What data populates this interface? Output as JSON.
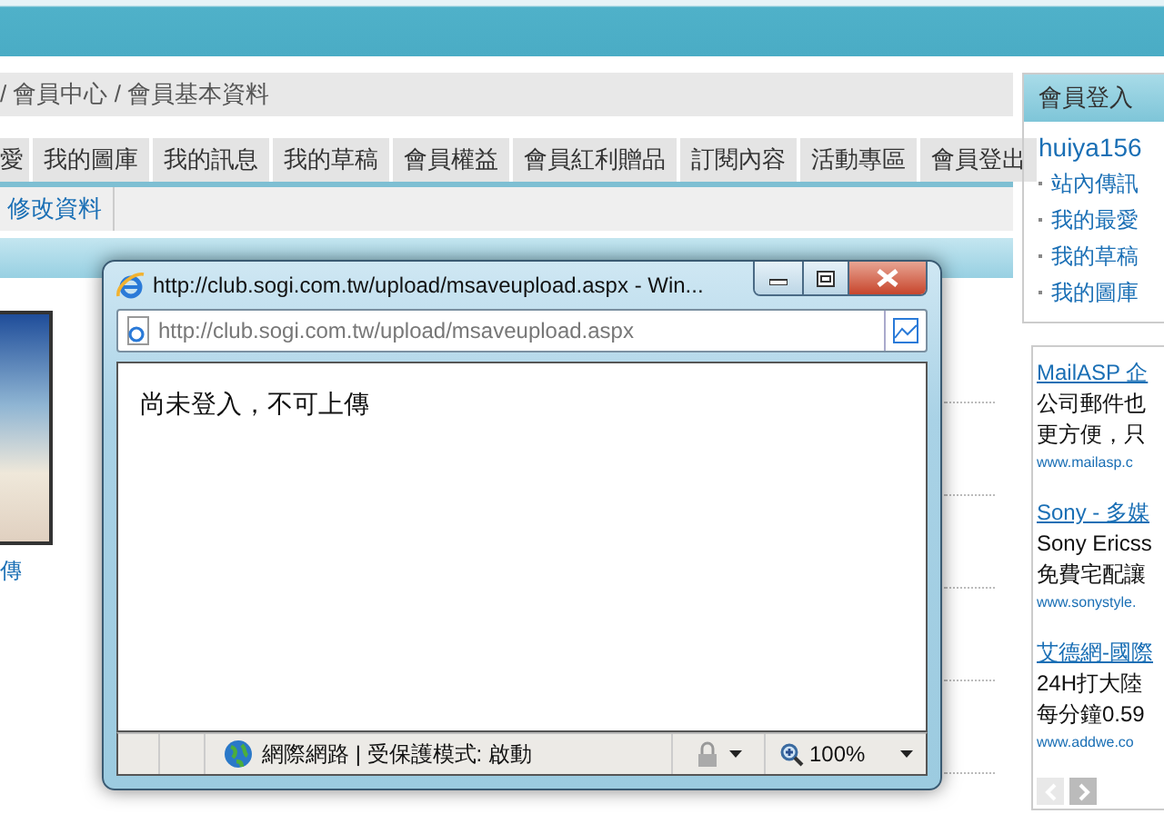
{
  "breadcrumb": "/ 會員中心 / 會員基本資料",
  "tabs": [
    {
      "label": "愛"
    },
    {
      "label": "我的圖庫"
    },
    {
      "label": "我的訊息"
    },
    {
      "label": "我的草稿"
    },
    {
      "label": "會員權益"
    },
    {
      "label": "會員紅利贈品"
    },
    {
      "label": "訂閱內容"
    },
    {
      "label": "活動專區"
    },
    {
      "label": "會員登出"
    }
  ],
  "subtabs": [
    {
      "label": "修改資料"
    }
  ],
  "photo_caption": "傳",
  "login_box": {
    "title": "會員登入",
    "username": "huiya156",
    "links": [
      "站內傳訊",
      "我的最愛",
      "我的草稿",
      "我的圖庫"
    ]
  },
  "ads": [
    {
      "title": "MailASP 企",
      "lines": [
        "公司郵件也",
        "更方便，只"
      ],
      "url": "www.mailasp.c"
    },
    {
      "title": "Sony - 多媒",
      "lines": [
        "Sony Ericss",
        "免費宅配讓"
      ],
      "url": "www.sonystyle."
    },
    {
      "title": "艾德網-國際",
      "lines": [
        "24H打大陸",
        "每分鐘0.59"
      ],
      "url": "www.addwe.co"
    }
  ],
  "popup": {
    "title": "http://club.sogi.com.tw/upload/msaveupload.aspx - Win...",
    "address": "http://club.sogi.com.tw/upload/msaveupload.aspx",
    "message": "尚未登入，不可上傳",
    "zone": "網際網路 | 受保護模式: 啟動",
    "zoom": "100%"
  }
}
